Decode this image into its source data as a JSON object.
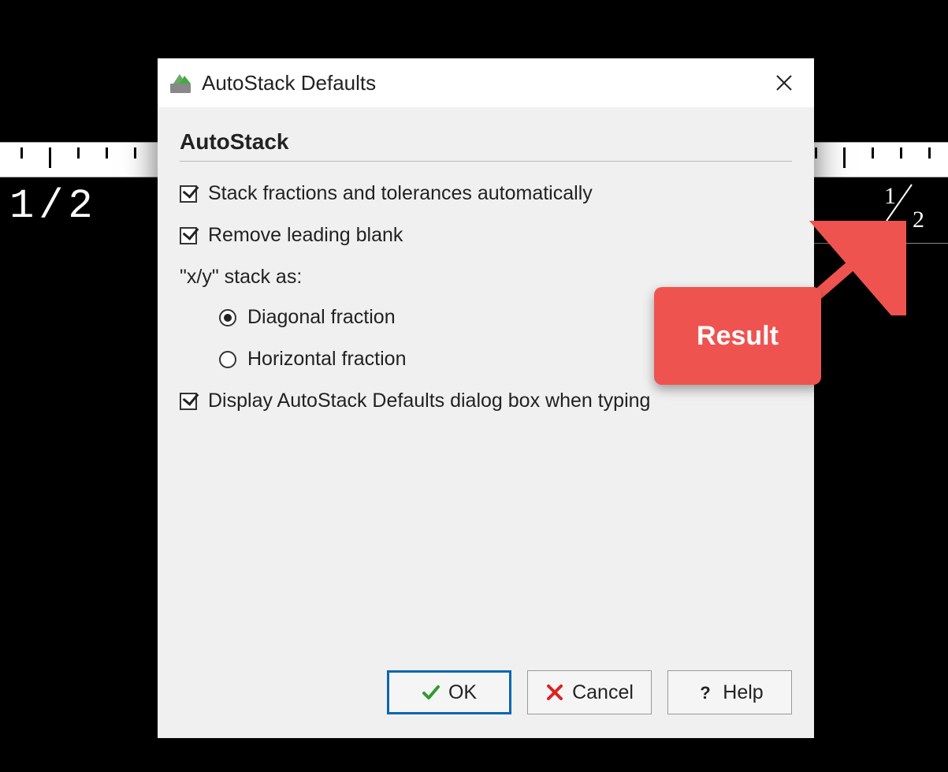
{
  "background": {
    "left_text": "1/2",
    "right_fraction": {
      "numerator": "1",
      "denominator": "2"
    }
  },
  "dialog": {
    "title": "AutoStack Defaults",
    "section_title": "AutoStack",
    "options": {
      "stack_auto": {
        "label": "Stack fractions and tolerances automatically",
        "checked": true
      },
      "remove_blank": {
        "label": "Remove leading blank",
        "checked": true
      },
      "stack_as_label": "\"x/y\" stack as:",
      "radio": {
        "diagonal": {
          "label": "Diagonal fraction",
          "selected": true
        },
        "horizontal": {
          "label": "Horizontal fraction",
          "selected": false
        }
      },
      "display_dialog": {
        "label": "Display AutoStack Defaults dialog box when typing",
        "checked": true
      }
    },
    "buttons": {
      "ok": "OK",
      "cancel": "Cancel",
      "help": "Help"
    }
  },
  "annotation": {
    "label": "Result"
  }
}
